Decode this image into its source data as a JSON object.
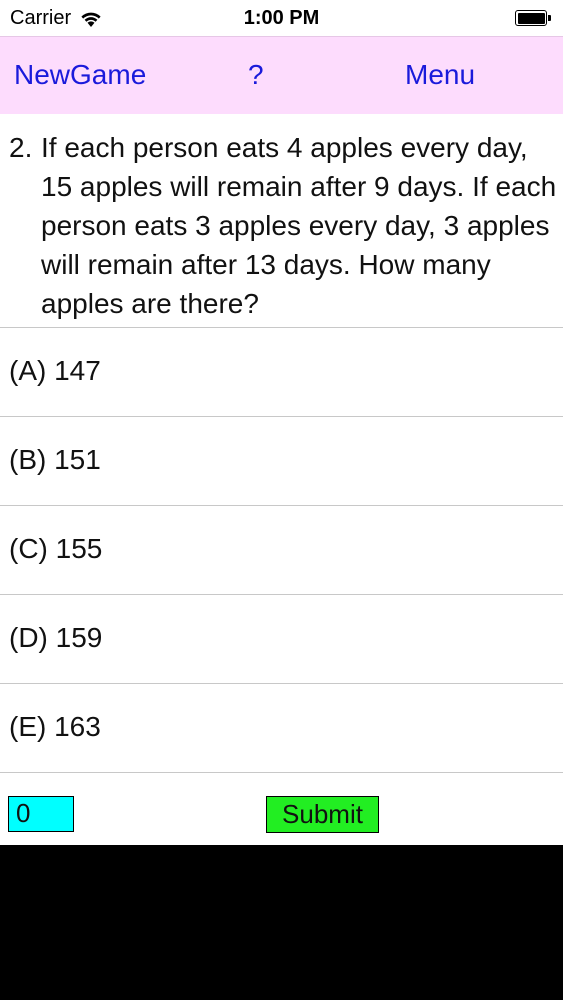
{
  "status_bar": {
    "carrier": "Carrier",
    "time": "1:00 PM",
    "wifi_icon": "wifi-icon",
    "battery_icon": "battery-full-icon"
  },
  "nav": {
    "new_game": "NewGame",
    "help": "?",
    "menu": "Menu",
    "link_color": "#1a1adb",
    "background_color": "#fddcfd"
  },
  "question": {
    "number": "2.",
    "text": "If each person eats 4 apples every day, 15 apples will remain after 9 days. If each person eats 3 apples every day, 3 apples will remain after 13 days.  How many apples are there?"
  },
  "options": [
    {
      "label": "(A) 147"
    },
    {
      "label": "(B) 151"
    },
    {
      "label": "(C) 155"
    },
    {
      "label": "(D) 159"
    },
    {
      "label": "(E) 163"
    }
  ],
  "answer": {
    "value": "0",
    "box_color": "#00ffff"
  },
  "submit": {
    "label": "Submit",
    "color": "#22ee22"
  }
}
